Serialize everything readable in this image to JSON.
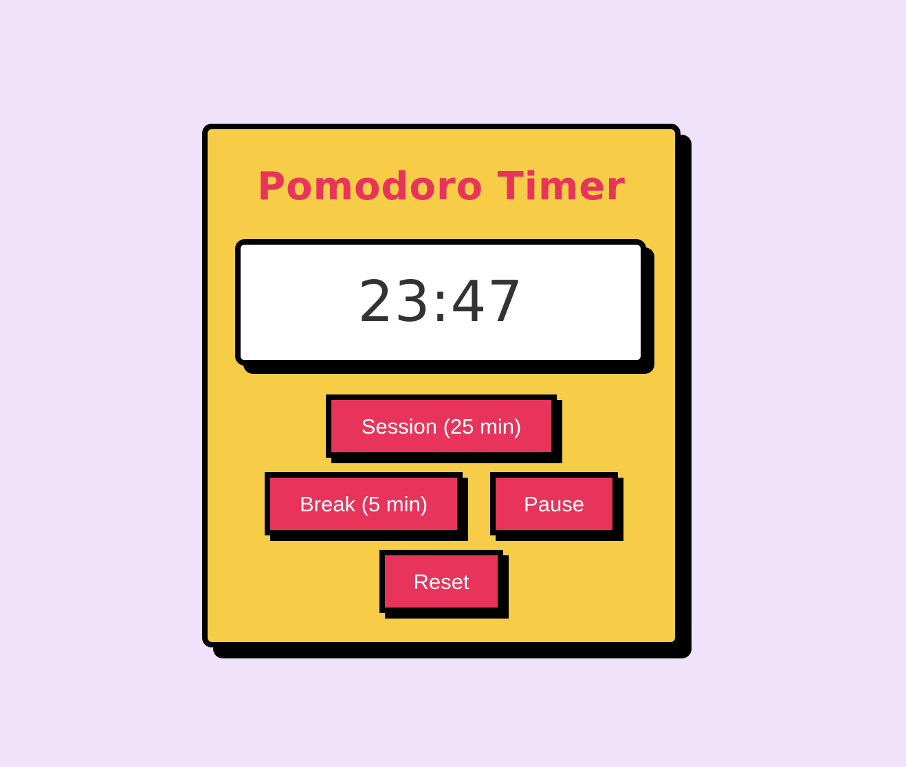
{
  "app": {
    "title": "Pomodoro Timer"
  },
  "timer": {
    "display": "23:47"
  },
  "controls": {
    "session_label": "Session (25 min)",
    "break_label": "Break (5 min)",
    "pause_label": "Pause",
    "reset_label": "Reset"
  },
  "colors": {
    "page_background": "#efe2fa",
    "card_background": "#f7cd48",
    "accent": "#e8345a",
    "border": "#000000",
    "display_background": "#ffffff",
    "display_text": "#333333",
    "button_text": "#ffffff"
  }
}
